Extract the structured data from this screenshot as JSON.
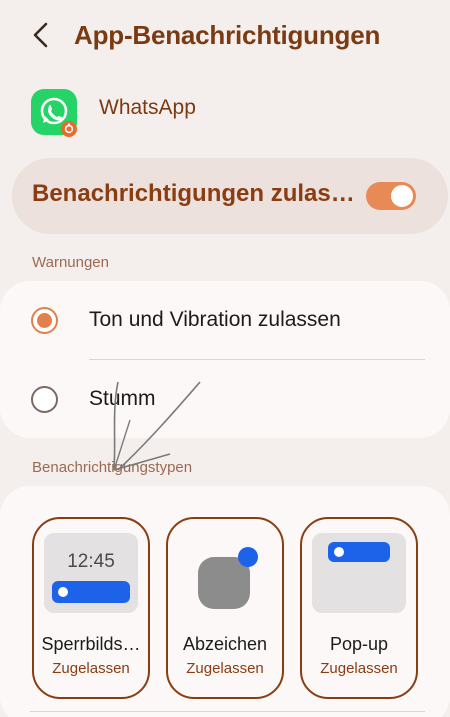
{
  "header": {
    "title": "App-Benachrichtigungen",
    "back_icon": "chevron-left-icon"
  },
  "app": {
    "name": "WhatsApp",
    "icon": "whatsapp-icon"
  },
  "master_toggle": {
    "label": "Benachrichtigungen zulassen",
    "display_label": "Benachrichtigungen zulass…",
    "on": true
  },
  "alerts": {
    "section_label": "Warnungen",
    "options": [
      {
        "label": "Ton und Vibration zulassen",
        "selected": true
      },
      {
        "label": "Stumm",
        "selected": false
      }
    ]
  },
  "types": {
    "section_label": "Benachrichtigungstypen",
    "items": [
      {
        "name": "Sperrbilds…",
        "status": "Zugelassen",
        "preview_time": "12:45"
      },
      {
        "name": "Abzeichen",
        "status": "Zugelassen"
      },
      {
        "name": "Pop-up",
        "status": "Zugelassen"
      }
    ]
  },
  "colors": {
    "accent": "#e0804c",
    "brand_text": "#7a3a12",
    "notification_blue": "#1c63ea",
    "whatsapp_green": "#25d366"
  }
}
